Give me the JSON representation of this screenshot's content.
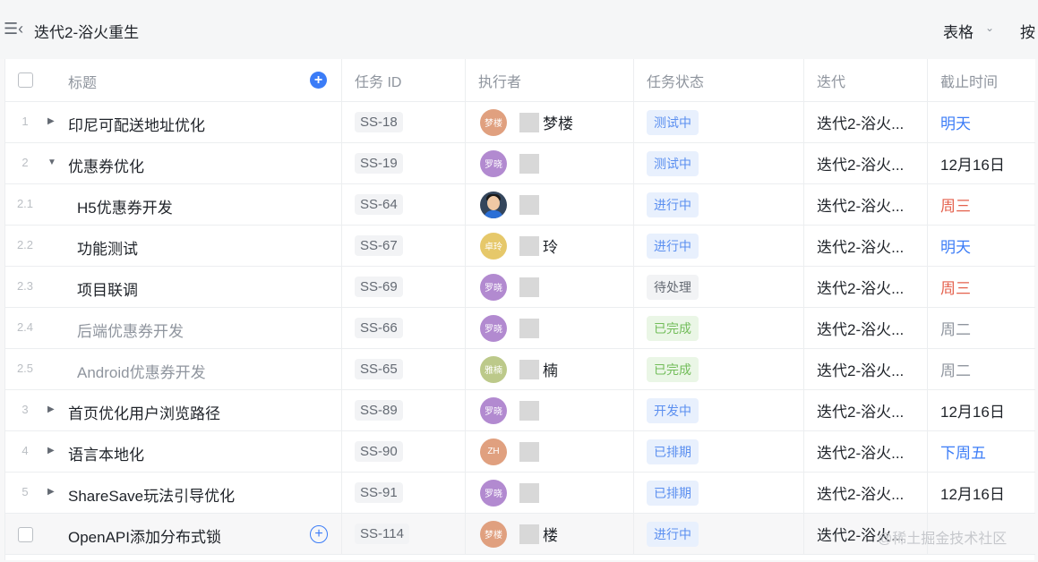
{
  "toolbar": {
    "menu_icon": "menu-collapse-icon",
    "sprint_title": "迭代2-浴火重生",
    "view_label": "表格",
    "view_chevron": "chevron-down-icon",
    "more_label": "按"
  },
  "columns": {
    "title": "标题",
    "task_id": "任务 ID",
    "assignee": "执行者",
    "status": "任务状态",
    "sprint": "迭代",
    "due": "截止时间"
  },
  "colors": {
    "accent": "#3b7cf7",
    "status_blue_bg": "#e8f0fd",
    "status_green_bg": "#eaf6e6",
    "due_red": "#e4614d"
  },
  "rows": [
    {
      "index": "1",
      "expander": "collapsed",
      "title": "印尼可配送地址优化",
      "id": "SS-18",
      "avatar_text": "梦楼",
      "avatar_color": "#e0a07f",
      "name": "梦楼",
      "status": "测试中",
      "sprint": "迭代2-浴火...",
      "due": "明天"
    },
    {
      "index": "2",
      "expander": "expanded",
      "title": "优惠券优化",
      "id": "SS-19",
      "avatar_text": "罗晓",
      "avatar_color": "#b28ad0",
      "name": "",
      "status": "测试中",
      "sprint": "迭代2-浴火...",
      "due": "12月16日"
    },
    {
      "index": "2.1",
      "expander": "",
      "title": "H5优惠券开发",
      "id": "SS-64",
      "avatar_text": "",
      "avatar_color": "#34465c",
      "name": "",
      "status": "进行中",
      "sprint": "迭代2-浴火...",
      "due": "周三"
    },
    {
      "index": "2.2",
      "expander": "",
      "title": "功能测试",
      "id": "SS-67",
      "avatar_text": "卓玲",
      "avatar_color": "#e6c86a",
      "name": "玲",
      "status": "进行中",
      "sprint": "迭代2-浴火...",
      "due": "明天"
    },
    {
      "index": "2.3",
      "expander": "",
      "title": "项目联调",
      "id": "SS-69",
      "avatar_text": "罗晓",
      "avatar_color": "#b28ad0",
      "name": "",
      "status": "待处理",
      "sprint": "迭代2-浴火...",
      "due": "周三"
    },
    {
      "index": "2.4",
      "expander": "",
      "title": "后端优惠券开发",
      "id": "SS-66",
      "avatar_text": "罗晓",
      "avatar_color": "#b28ad0",
      "name": "",
      "status": "已完成",
      "sprint": "迭代2-浴火...",
      "due": "周二"
    },
    {
      "index": "2.5",
      "expander": "",
      "title": "Android优惠券开发",
      "id": "SS-65",
      "avatar_text": "雅楠",
      "avatar_color": "#bcc98a",
      "name": "楠",
      "status": "已完成",
      "sprint": "迭代2-浴火...",
      "due": "周二"
    },
    {
      "index": "3",
      "expander": "collapsed",
      "title": "首页优化用户浏览路径",
      "id": "SS-89",
      "avatar_text": "罗晓",
      "avatar_color": "#b28ad0",
      "name": "",
      "status": "开发中",
      "sprint": "迭代2-浴火...",
      "due": "12月16日"
    },
    {
      "index": "4",
      "expander": "collapsed",
      "title": "语言本地化",
      "id": "SS-90",
      "avatar_text": "ZH",
      "avatar_color": "#e0a07f",
      "name": "",
      "status": "已排期",
      "sprint": "迭代2-浴火...",
      "due": "下周五"
    },
    {
      "index": "5",
      "expander": "collapsed",
      "title": "ShareSave玩法引导优化",
      "id": "SS-91",
      "avatar_text": "罗晓",
      "avatar_color": "#b28ad0",
      "name": "",
      "status": "已排期",
      "sprint": "迭代2-浴火...",
      "due": "12月16日"
    }
  ],
  "new_row": {
    "title": "OpenAPI添加分布式锁",
    "id": "SS-114",
    "avatar_text": "梦楼",
    "avatar_color": "#e0a07f",
    "name": "楼",
    "status": "进行中",
    "sprint": "迭代2-浴火...",
    "due": ""
  },
  "watermark": "@稀土掘金技术社区"
}
